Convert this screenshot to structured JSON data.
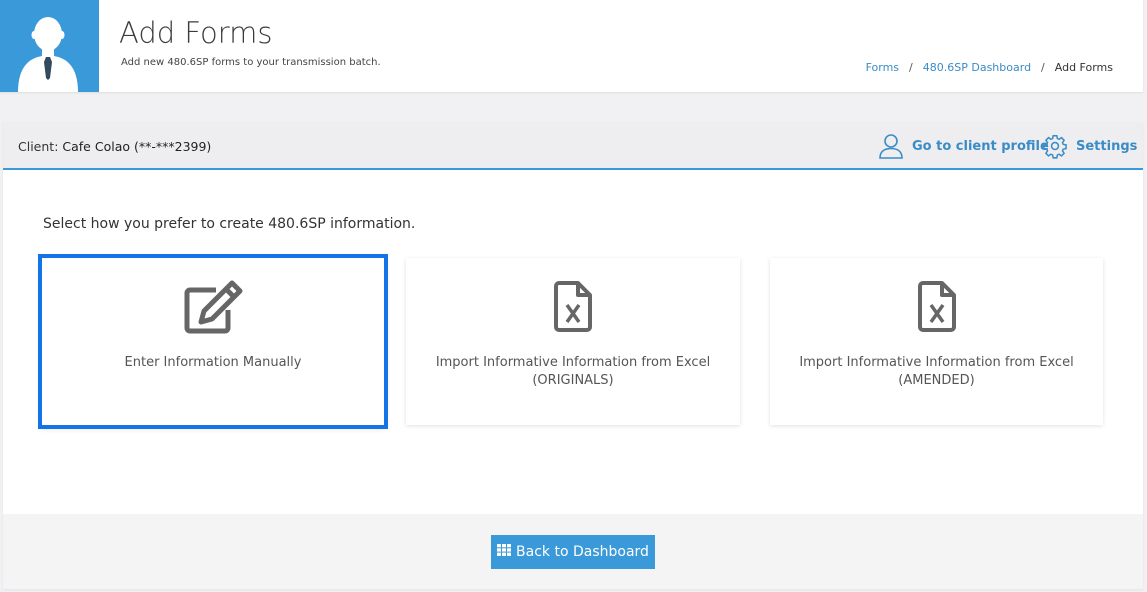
{
  "header": {
    "title": "Add Forms",
    "subtitle": "Add new 480.6SP forms to your transmission batch.",
    "avatar_icon": "user-avatar-icon",
    "avatar_bg": "#3a99d8",
    "breadcrumb": [
      {
        "label": "Forms",
        "link": true
      },
      {
        "label": "480.6SP Dashboard",
        "link": true
      },
      {
        "label": "Add Forms",
        "link": false
      }
    ],
    "breadcrumb_separator": "/"
  },
  "client_bar": {
    "label": "Client:",
    "client_name": "Cafe Colao (**-***2399)",
    "profile_link": "Go to client profile",
    "profile_icon": "user-outline-icon",
    "settings_link": "Settings",
    "settings_icon": "gear-icon",
    "accent": "#3a99d8"
  },
  "main": {
    "prompt": "Select how you prefer to create 480.6SP information.",
    "options": [
      {
        "line1": "Enter Information Manually",
        "line2": "",
        "icon": "edit-icon",
        "selected": true
      },
      {
        "line1": "Import Informative Information from Excel",
        "line2": "(ORIGINALS)",
        "icon": "excel-file-icon",
        "selected": false
      },
      {
        "line1": "Import Informative Information from Excel",
        "line2": "(AMENDED)",
        "icon": "excel-file-icon",
        "selected": false
      }
    ],
    "selection_color": "#1573e8"
  },
  "footer": {
    "back_button": "Back to Dashboard",
    "back_icon": "grid-icon"
  }
}
